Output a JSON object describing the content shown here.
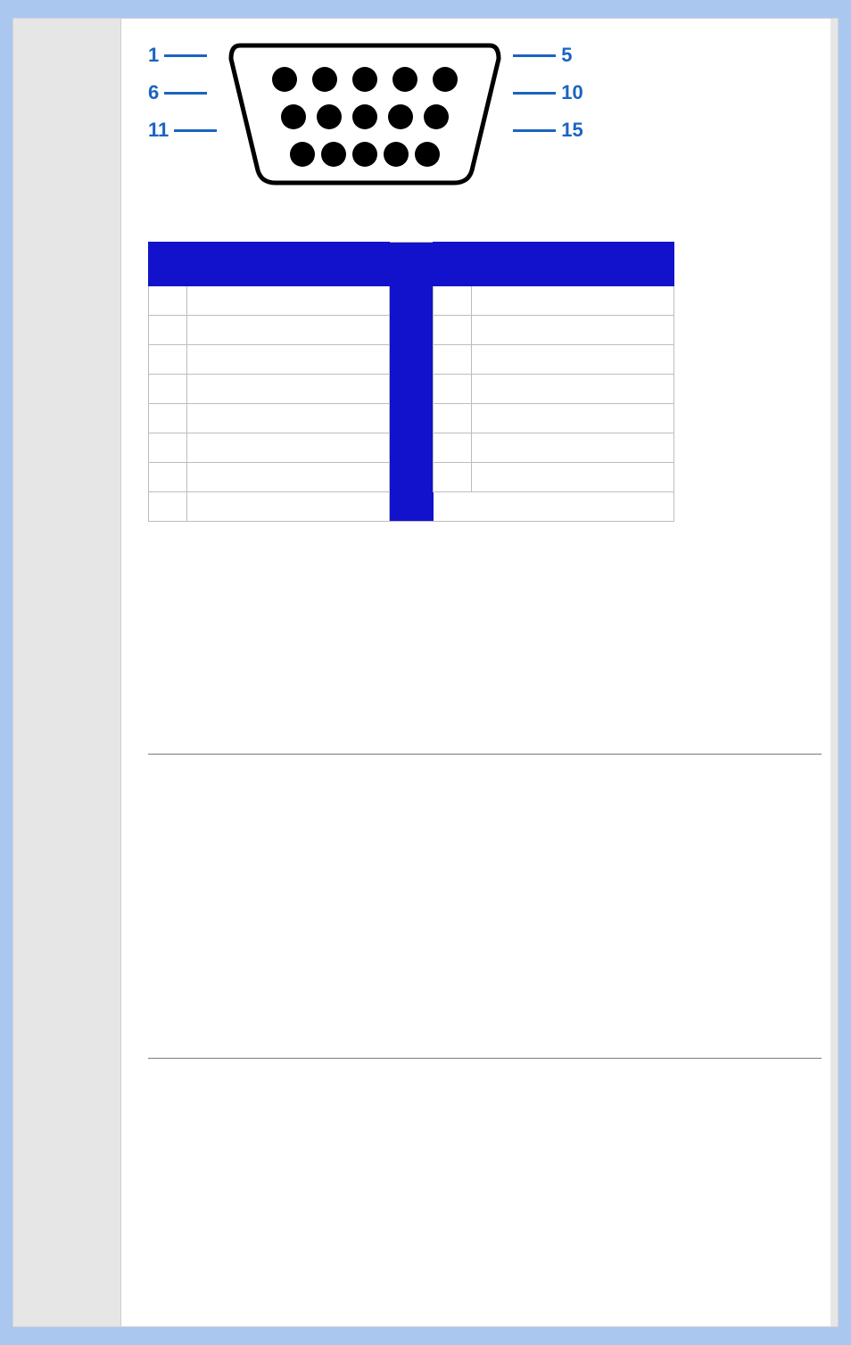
{
  "connector": {
    "left_labels": [
      "1",
      "6",
      "11"
    ],
    "right_labels": [
      "5",
      "10",
      "15"
    ],
    "label_color": "#1a64c2",
    "pins_total": 15,
    "rows": [
      5,
      5,
      5
    ]
  },
  "pin_table": {
    "headers": {
      "left_pin": "",
      "left_signal": "",
      "right_pin": "",
      "right_signal": ""
    },
    "left": [
      {
        "pin": "",
        "signal": ""
      },
      {
        "pin": "",
        "signal": ""
      },
      {
        "pin": "",
        "signal": ""
      },
      {
        "pin": "",
        "signal": ""
      },
      {
        "pin": "",
        "signal": ""
      },
      {
        "pin": "",
        "signal": ""
      },
      {
        "pin": "",
        "signal": ""
      },
      {
        "pin": "",
        "signal": ""
      }
    ],
    "right": [
      {
        "pin": "",
        "signal": ""
      },
      {
        "pin": "",
        "signal": ""
      },
      {
        "pin": "",
        "signal": ""
      },
      {
        "pin": "",
        "signal": ""
      },
      {
        "pin": "",
        "signal": ""
      },
      {
        "pin": "",
        "signal": ""
      },
      {
        "pin": "",
        "signal": ""
      }
    ]
  },
  "sections": {
    "a_heading": "",
    "a_body": "",
    "b_heading": "",
    "b_body": ""
  },
  "colors": {
    "page_bg": "#aac7f0",
    "sidebar_bg": "#e6e6e6",
    "table_header_bg": "#1212cc",
    "label_blue": "#1a64c2",
    "divider": "#7a7a7a"
  }
}
